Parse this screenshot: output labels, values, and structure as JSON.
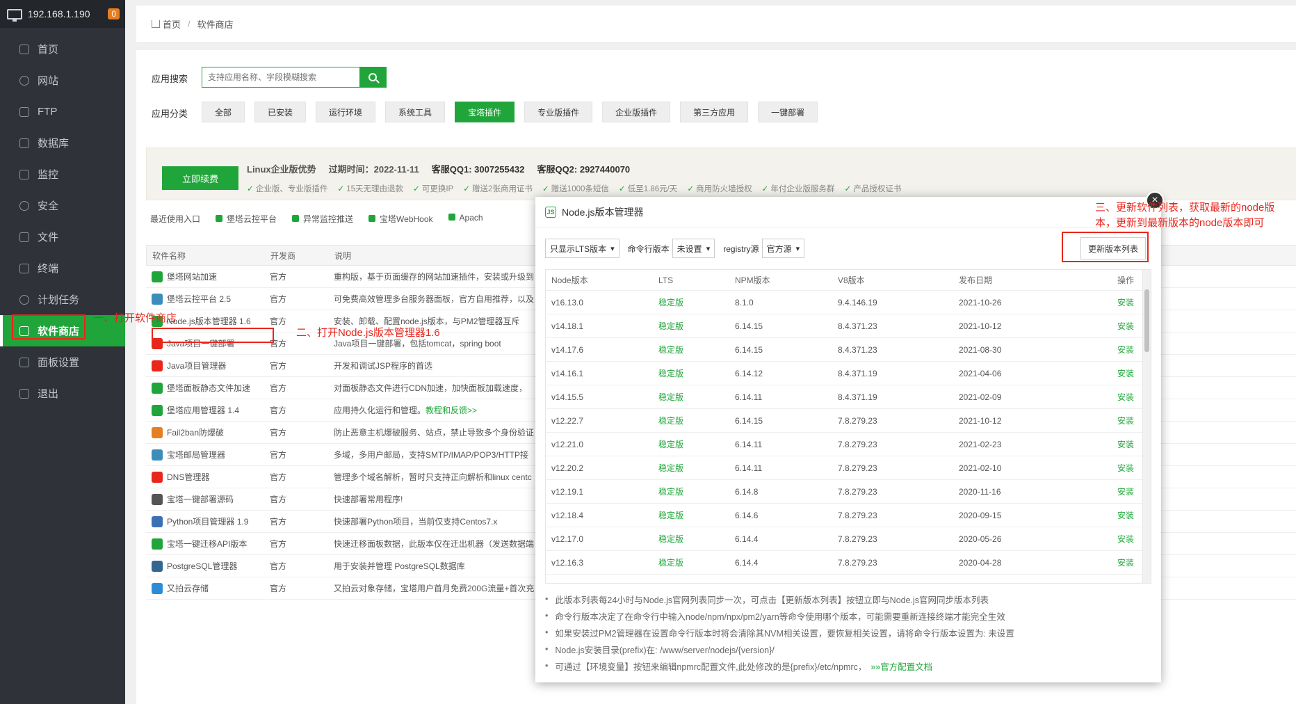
{
  "sidebar": {
    "ip": "192.168.1.190",
    "badge": "0",
    "items": [
      {
        "label": "首页",
        "icon": "home-icon"
      },
      {
        "label": "网站",
        "icon": "globe-icon"
      },
      {
        "label": "FTP",
        "icon": "ftp-icon"
      },
      {
        "label": "数据库",
        "icon": "database-icon"
      },
      {
        "label": "监控",
        "icon": "monitor-icon"
      },
      {
        "label": "安全",
        "icon": "shield-icon"
      },
      {
        "label": "文件",
        "icon": "folder-icon"
      },
      {
        "label": "终端",
        "icon": "terminal-icon"
      },
      {
        "label": "计划任务",
        "icon": "clock-icon"
      },
      {
        "label": "软件商店",
        "icon": "grid-icon"
      },
      {
        "label": "面板设置",
        "icon": "gear-icon"
      },
      {
        "label": "退出",
        "icon": "logout-icon"
      }
    ]
  },
  "breadcrumb": {
    "home": "首页",
    "current": "软件商店"
  },
  "search": {
    "label": "应用搜索",
    "placeholder": "支持应用名称、字段模糊搜索"
  },
  "categories": {
    "label": "应用分类",
    "items": [
      "全部",
      "已安装",
      "运行环境",
      "系统工具",
      "宝塔插件",
      "专业版插件",
      "企业版插件",
      "第三方应用",
      "一键部署"
    ]
  },
  "promo": {
    "renew": "立即续费",
    "title": "Linux企业版优势",
    "expire": "过期时间：2022-11-11",
    "qq1": "客服QQ1: 3007255432",
    "qq2": "客服QQ2: 2927440070",
    "features": [
      "企业版、专业版插件",
      "15天无理由退款",
      "可更换IP",
      "赠送2张商用证书",
      "赠送1000条短信",
      "低至1.86元/天",
      "商用防火墙授权",
      "年付企业版服务群",
      "产品授权证书"
    ]
  },
  "recent": {
    "label": "最近使用入口",
    "items": [
      "堡塔云控平台",
      "异常监控推送",
      "宝塔WebHook",
      "Apach"
    ]
  },
  "table": {
    "headers": [
      "软件名称",
      "开发商",
      "说明"
    ],
    "rows": [
      {
        "name": "堡塔网站加速",
        "dev": "官方",
        "desc": "重构版，基于页面缓存的网站加速插件，安装或升级到",
        "color": "#20a53a"
      },
      {
        "name": "堡塔云控平台 2.5",
        "dev": "官方",
        "desc": "可免费高效管理多台服务器面板，官方自用推荐，以及",
        "color": "#3c8dbc"
      },
      {
        "name": "Node.js版本管理器 1.6",
        "dev": "官方",
        "desc": "安装、卸载、配置node.js版本，与PM2管理器互斥",
        "color": "#20a53a"
      },
      {
        "name": "Java项目一键部署",
        "dev": "官方",
        "desc": "Java项目一键部署，包括tomcat，spring boot",
        "color": "#e8261c"
      },
      {
        "name": "Java项目管理器",
        "dev": "官方",
        "desc": "开发和调试JSP程序的首选",
        "color": "#e8261c"
      },
      {
        "name": "堡塔面板静态文件加速",
        "dev": "官方",
        "desc": "对面板静态文件进行CDN加速，加快面板加载速度，",
        "color": "#20a53a"
      },
      {
        "name": "堡塔应用管理器 1.4",
        "dev": "官方",
        "desc": "应用持久化运行和管理。",
        "link": "教程和反馈>>",
        "color": "#20a53a"
      },
      {
        "name": "Fail2ban防爆破",
        "dev": "官方",
        "desc": "防止恶意主机爆破服务、站点，禁止导致多个身份验证",
        "color": "#e67e22"
      },
      {
        "name": "宝塔邮局管理器",
        "dev": "官方",
        "desc": "多域，多用户邮局，支持SMTP/IMAP/POP3/HTTP接",
        "color": "#3c8dbc"
      },
      {
        "name": "DNS管理器",
        "dev": "官方",
        "desc": "管理多个域名解析，暂时只支持正向解析和linux centc",
        "color": "#e8261c"
      },
      {
        "name": "宝塔一键部署源码",
        "dev": "官方",
        "desc": "快速部署常用程序!",
        "color": "#555555"
      },
      {
        "name": "Python项目管理器 1.9",
        "dev": "官方",
        "desc": "快速部署Python项目，当前仅支持Centos7.x",
        "color": "#3c6fb4"
      },
      {
        "name": "宝塔一键迁移API版本",
        "dev": "官方",
        "desc": "快速迁移面板数据，此版本仅在迁出机器（发送数据端",
        "color": "#20a53a"
      },
      {
        "name": "PostgreSQL管理器",
        "dev": "官方",
        "desc": "用于安装并管理 PostgreSQL数据库",
        "color": "#336791"
      },
      {
        "name": "又拍云存储",
        "dev": "官方",
        "desc": "又拍云对象存储，宝塔用户首月免费200G流量+首次充",
        "color": "#2c8dd6"
      }
    ]
  },
  "modal": {
    "title": "Node.js版本管理器",
    "close": "×",
    "filter": "只显示LTS版本",
    "cli_label": "命令行版本",
    "cli_value": "未设置",
    "registry_label": "registry源",
    "registry_value": "官方源",
    "update_btn": "更新版本列表",
    "headers": [
      "Node版本",
      "LTS",
      "NPM版本",
      "V8版本",
      "发布日期",
      "操作"
    ],
    "rows": [
      {
        "v": "v16.13.0",
        "lts": "稳定版",
        "npm": "8.1.0",
        "v8": "9.4.146.19",
        "date": "2021-10-26",
        "op": "安装"
      },
      {
        "v": "v14.18.1",
        "lts": "稳定版",
        "npm": "6.14.15",
        "v8": "8.4.371.23",
        "date": "2021-10-12",
        "op": "安装"
      },
      {
        "v": "v14.17.6",
        "lts": "稳定版",
        "npm": "6.14.15",
        "v8": "8.4.371.23",
        "date": "2021-08-30",
        "op": "安装"
      },
      {
        "v": "v14.16.1",
        "lts": "稳定版",
        "npm": "6.14.12",
        "v8": "8.4.371.19",
        "date": "2021-04-06",
        "op": "安装"
      },
      {
        "v": "v14.15.5",
        "lts": "稳定版",
        "npm": "6.14.11",
        "v8": "8.4.371.19",
        "date": "2021-02-09",
        "op": "安装"
      },
      {
        "v": "v12.22.7",
        "lts": "稳定版",
        "npm": "6.14.15",
        "v8": "7.8.279.23",
        "date": "2021-10-12",
        "op": "安装"
      },
      {
        "v": "v12.21.0",
        "lts": "稳定版",
        "npm": "6.14.11",
        "v8": "7.8.279.23",
        "date": "2021-02-23",
        "op": "安装"
      },
      {
        "v": "v12.20.2",
        "lts": "稳定版",
        "npm": "6.14.11",
        "v8": "7.8.279.23",
        "date": "2021-02-10",
        "op": "安装"
      },
      {
        "v": "v12.19.1",
        "lts": "稳定版",
        "npm": "6.14.8",
        "v8": "7.8.279.23",
        "date": "2020-11-16",
        "op": "安装"
      },
      {
        "v": "v12.18.4",
        "lts": "稳定版",
        "npm": "6.14.6",
        "v8": "7.8.279.23",
        "date": "2020-09-15",
        "op": "安装"
      },
      {
        "v": "v12.17.0",
        "lts": "稳定版",
        "npm": "6.14.4",
        "v8": "7.8.279.23",
        "date": "2020-05-26",
        "op": "安装"
      },
      {
        "v": "v12.16.3",
        "lts": "稳定版",
        "npm": "6.14.4",
        "v8": "7.8.279.23",
        "date": "2020-04-28",
        "op": "安装"
      }
    ],
    "notes": [
      "此版本列表每24小时与Node.js官网列表同步一次，可点击【更新版本列表】按钮立即与Node.js官网同步版本列表",
      "命令行版本决定了在命令行中输入node/npm/npx/pm2/yarn等命令使用哪个版本，可能需要重新连接终端才能完全生效",
      "如果安装过PM2管理器在设置命令行版本时将会清除其NVM相关设置，要恢复相关设置，请将命令行版本设置为: 未设置",
      "Node.js安装目录(prefix)在: /www/server/nodejs/{version}/",
      "可通过【环境变量】按钮来编辑npmrc配置文件,此处修改的是{prefix}/etc/npmrc，"
    ],
    "notes_link": "»»官方配置文档"
  },
  "annotations": {
    "step1": "一、打开软件商店",
    "step2": "二、打开Node.js版本管理器1.6",
    "step3_line1": "三、更新软件列表，获取最新的node版",
    "step3_line2": "本，更新到最新版本的node版本即可"
  }
}
